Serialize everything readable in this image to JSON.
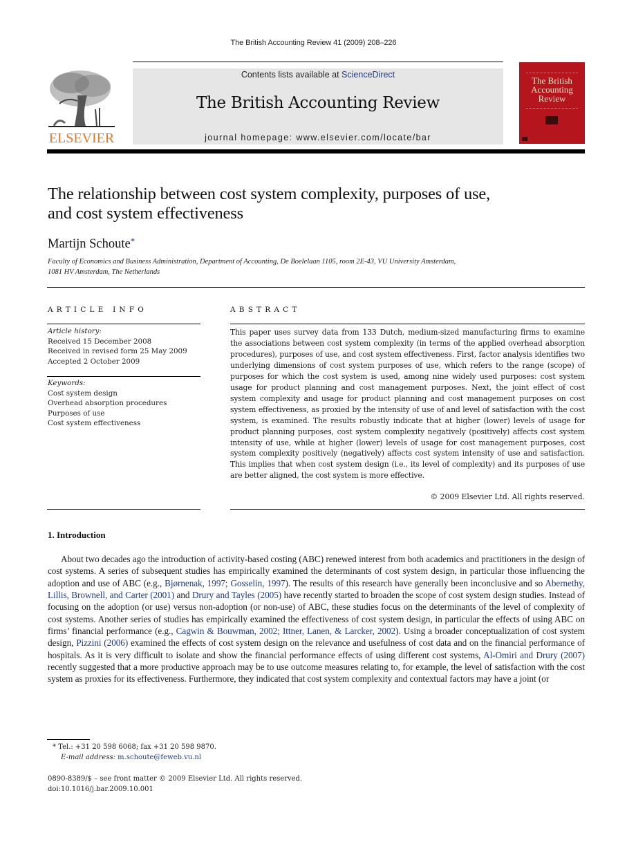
{
  "running_head": "The British Accounting Review 41 (2009) 208–226",
  "masthead": {
    "publisher_wordmark": "ELSEVIER",
    "contents_prefix": "Contents lists available at ",
    "contents_link": "ScienceDirect",
    "journal_name": "The British Accounting Review",
    "homepage_label": "journal homepage: www.elsevier.com/locate/bar",
    "cover_title_lines": [
      "The British",
      "Accounting",
      "Review"
    ],
    "colors": {
      "elsevier_orange": "#e87722",
      "cover_red": "#b5161e",
      "link_blue": "#1d3a8a",
      "masthead_gray": "#e6e6e6"
    }
  },
  "article": {
    "title_line1": "The relationship between cost system complexity, purposes of use,",
    "title_line2": "and cost system effectiveness",
    "author": "Martijn Schoute",
    "author_mark": "*",
    "affiliation_line1": "Faculty of Economics and Business Administration, Department of Accounting, De Boelelaan 1105, room 2E-43, VU University Amsterdam,",
    "affiliation_line2": "1081 HV Amsterdam, The Netherlands"
  },
  "article_info": {
    "heading": "ARTICLE INFO",
    "history_label": "Article history:",
    "history": [
      "Received 15 December 2008",
      "Received in revised form 25 May 2009",
      "Accepted 2 October 2009"
    ],
    "keywords_label": "Keywords:",
    "keywords": [
      "Cost system design",
      "Overhead absorption procedures",
      "Purposes of use",
      "Cost system effectiveness"
    ]
  },
  "abstract": {
    "heading": "ABSTRACT",
    "text": "This paper uses survey data from 133 Dutch, medium-sized manufacturing firms to examine the associations between cost system complexity (in terms of the applied over­head absorption procedures), purposes of use, and cost system effectiveness. First, factor analysis identifies two underlying dimensions of cost system purposes of use, which refers to the range (scope) of purposes for which the cost system is used, among nine widely used purposes: cost system usage for product planning and cost management purposes. Next, the joint effect of cost system complexity and usage for product planning and cost management purposes on cost system effectiveness, as proxied by the intensity of use of and level of satisfaction with the cost system, is examined. The results robustly indicate that at higher (lower) levels of usage for product planning purposes, cost system complexity negatively (positively) affects cost system intensity of use, while at higher (lower) levels of usage for cost management purposes, cost system complexity positively (negatively) affects cost system intensity of use and satisfaction. This implies that when cost system design (i.e., its level of complexity) and its purposes of use are better aligned, the cost system is more effective.",
    "copyright": "© 2009 Elsevier Ltd. All rights reserved."
  },
  "introduction": {
    "heading": "1.  Introduction",
    "segments": [
      {
        "t": "About two decades ago the introduction of activity-based costing (ABC) renewed interest from both academics and practitioners in the design of cost systems. A series of subsequent studies has empirically examined the determinants of cost system design, in particular those influencing the adoption and use of ABC (e.g., "
      },
      {
        "link": "Bjørnenak, 1997; Gosselin, 1997"
      },
      {
        "t": "). The results of this research have generally been inconclusive and so "
      },
      {
        "link": "Abernethy, Lillis, Brownell, and Carter (2001)"
      },
      {
        "t": " and "
      },
      {
        "link": "Drury and Tayles (2005)"
      },
      {
        "t": " have recently started to broaden the scope of cost system design studies. Instead of focusing on the adoption (or use) versus non-adoption (or non-use) of ABC, these studies focus on the determinants of the level of complexity of cost systems. Another series of studies has empirically examined the effectiveness of cost system design, in particular the effects of using ABC on firms’ financial performance (e.g., "
      },
      {
        "link": "Cagwin & Bouwman, 2002; Ittner, Lanen, & Larcker, 2002"
      },
      {
        "t": "). Using a broader conceptualization of cost system design, "
      },
      {
        "link": "Pizzini (2006)"
      },
      {
        "t": " examined the effects of cost system design on the relevance and usefulness of cost data and on the financial performance of hospitals. As it is very difficult to isolate and show the financial performance effects of using different cost systems, "
      },
      {
        "link": "Al-Omiri and Drury (2007)"
      },
      {
        "t": " recently suggested that a more productive approach may be to use outcome measures relating to, for example, the level of satisfaction with the cost system as proxies for its effectiveness. Furthermore, they indicated that cost system complexity and contextual factors may have a joint (or"
      }
    ]
  },
  "footnote": {
    "mark": "*",
    "tel": " Tel.: +31 20 598 6068; fax +31 20 598 9870.",
    "email_label": "E-mail address: ",
    "email": "m.schoute@feweb.vu.nl"
  },
  "front_matter": {
    "issn_line": "0890-8389/$ – see front matter © 2009 Elsevier Ltd. All rights reserved.",
    "doi": "doi:10.1016/j.bar.2009.10.001"
  }
}
